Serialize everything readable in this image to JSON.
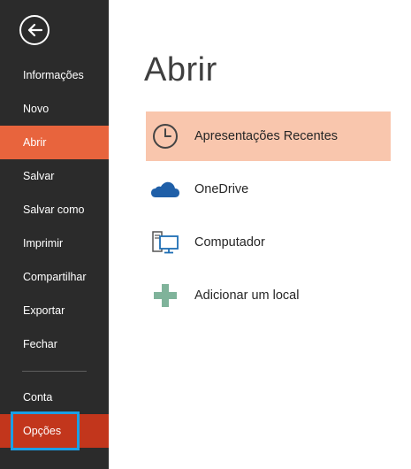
{
  "sidebar": {
    "back_icon": "back-arrow-icon",
    "items": [
      {
        "label": "Informações"
      },
      {
        "label": "Novo"
      },
      {
        "label": "Abrir",
        "active": true
      },
      {
        "label": "Salvar"
      },
      {
        "label": "Salvar como"
      },
      {
        "label": "Imprimir"
      },
      {
        "label": "Compartilhar"
      },
      {
        "label": "Exportar"
      },
      {
        "label": "Fechar"
      }
    ],
    "bottom_items": [
      {
        "label": "Conta"
      },
      {
        "label": "Opções",
        "highlighted": true
      }
    ]
  },
  "main": {
    "title": "Abrir",
    "locations": [
      {
        "label": "Apresentações Recentes",
        "icon": "clock-icon",
        "selected": true
      },
      {
        "label": "OneDrive",
        "icon": "cloud-icon"
      },
      {
        "label": "Computador",
        "icon": "computer-icon"
      },
      {
        "label": "Adicionar um local",
        "icon": "plus-icon"
      }
    ]
  },
  "colors": {
    "sidebar_bg": "#2b2b2b",
    "active_accent": "#e8643d",
    "options_bg": "#c2361c",
    "selected_row": "#f9c6ad",
    "highlight_border": "#1a9fe6",
    "onedrive_blue": "#1f5fa8",
    "plus_green": "#7fb39a"
  }
}
